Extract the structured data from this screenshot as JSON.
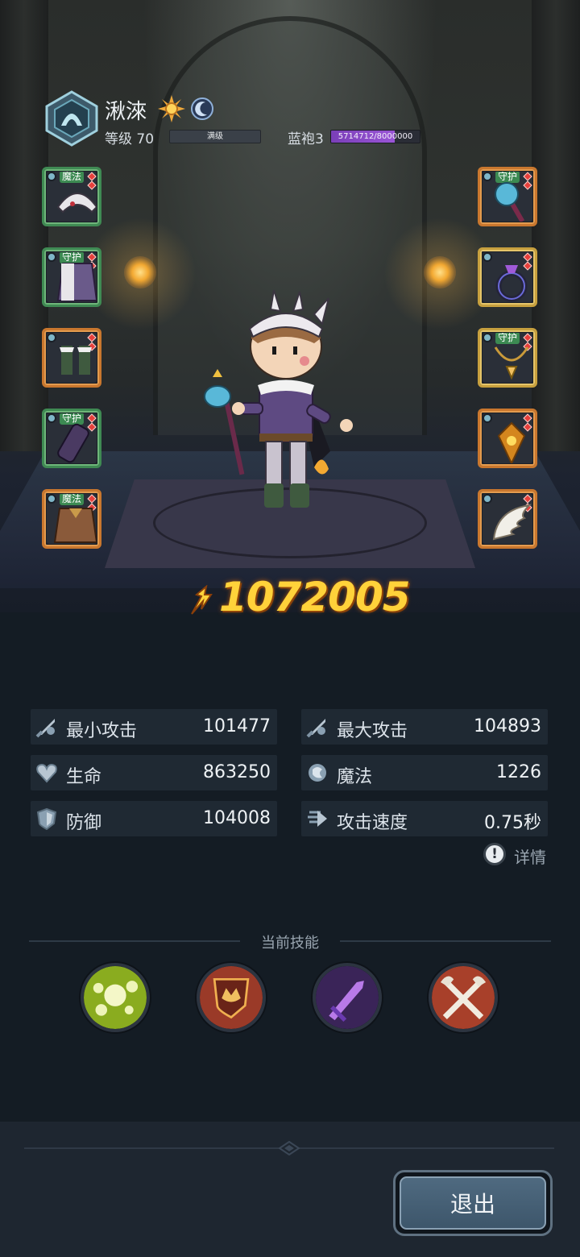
{
  "hero": {
    "name": "湫淶",
    "level_label": "等级 70",
    "level_status": "满级",
    "rank_label": "蓝袍3",
    "exp_text": "5714712/8000000",
    "exp_fraction": 0.714
  },
  "equipment_left": [
    {
      "tag": "魔法",
      "rarity": "green",
      "icon": "helmet-icon"
    },
    {
      "tag": "守护",
      "rarity": "green",
      "icon": "armor-icon"
    },
    {
      "tag": "",
      "rarity": "orange",
      "icon": "boots-icon"
    },
    {
      "tag": "守护",
      "rarity": "green",
      "icon": "bracer-icon"
    },
    {
      "tag": "魔法",
      "rarity": "orange",
      "icon": "cloak-icon"
    }
  ],
  "equipment_right": [
    {
      "tag": "守护",
      "rarity": "orange",
      "icon": "staff-icon"
    },
    {
      "tag": "",
      "rarity": "gold",
      "icon": "ring-icon"
    },
    {
      "tag": "守护",
      "rarity": "gold",
      "icon": "necklace-icon"
    },
    {
      "tag": "",
      "rarity": "orange",
      "icon": "talisman-icon"
    },
    {
      "tag": "",
      "rarity": "orange",
      "icon": "wing-icon"
    }
  ],
  "power": {
    "value": "1072005"
  },
  "stats": [
    {
      "label": "最小攻击",
      "value": "101477",
      "icon": "sword-icon"
    },
    {
      "label": "最大攻击",
      "value": "104893",
      "icon": "sword-icon"
    },
    {
      "label": "生命",
      "value": "863250",
      "icon": "heart-icon"
    },
    {
      "label": "魔法",
      "value": "1226",
      "icon": "magic-icon"
    },
    {
      "label": "防御",
      "value": "104008",
      "icon": "shield-icon"
    },
    {
      "label": "攻击速度",
      "value": "0.75秒",
      "icon": "speed-icon"
    }
  ],
  "detail_label": "详情",
  "skills": {
    "title": "当前技能",
    "items": [
      {
        "icon": "orbs-skill-icon",
        "color": "#9bbb2a"
      },
      {
        "icon": "shield-crest-skill-icon",
        "color": "#a8442e"
      },
      {
        "icon": "dagger-skill-icon",
        "color": "#5a3a8a"
      },
      {
        "icon": "crossed-axes-skill-icon",
        "color": "#b5432e"
      }
    ]
  },
  "exit_label": "退出",
  "colors": {
    "power": "#ffd23a",
    "exp": "#8a4ac8",
    "background": "#141c24"
  }
}
